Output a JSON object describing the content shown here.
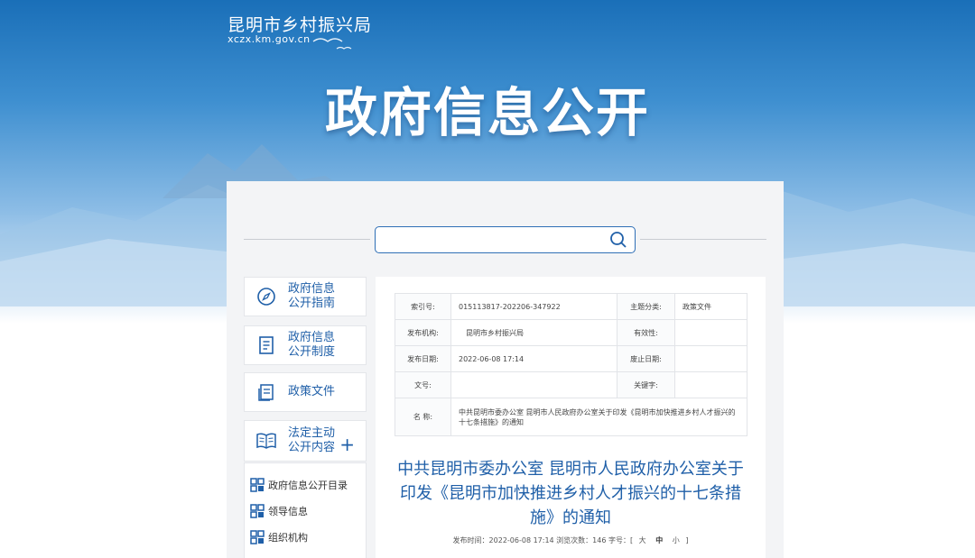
{
  "header": {
    "site_title": "昆明市乡村振兴局",
    "site_url": "xczx.km.gov.cn",
    "hero_title": "政府信息公开"
  },
  "search": {
    "value": "",
    "placeholder": ""
  },
  "sidebar": {
    "items": [
      {
        "label_line1": "政府信息",
        "label_line2": "公开指南",
        "icon": "compass-icon"
      },
      {
        "label_line1": "政府信息",
        "label_line2": "公开制度",
        "icon": "document-list-icon"
      },
      {
        "label": "政策文件",
        "icon": "policy-file-icon"
      },
      {
        "label_line1": "法定主动",
        "label_line2": "公开内容",
        "icon": "open-book-icon",
        "expand": "+"
      }
    ],
    "sub_items": [
      {
        "label": "政府信息公开目录",
        "icon": "grid-icon"
      },
      {
        "label": "领导信息",
        "icon": "grid-icon"
      },
      {
        "label": "组织机构",
        "icon": "grid-icon"
      }
    ]
  },
  "meta_table": {
    "index_label": "索引号:",
    "index_value": "015113817-202206-347922",
    "topic_label": "主题分类:",
    "topic_value": "政策文件",
    "publisher_label": "发布机构:",
    "publisher_value": "昆明市乡村振兴局",
    "validity_label": "有效性:",
    "validity_value": "",
    "pubdate_label": "发布日期:",
    "pubdate_value": "2022-06-08 17:14",
    "expire_label": "废止日期:",
    "expire_value": "",
    "docno_label": "文号:",
    "docno_value": "",
    "keyword_label": "关键字:",
    "keyword_value": "",
    "name_label": "名 称:",
    "name_value": "中共昆明市委办公室 昆明市人民政府办公室关于印发《昆明市加快推进乡村人才振兴的十七条措施》的通知"
  },
  "document": {
    "title_line1": "中共昆明市委办公室 昆明市人民政府办公室关于",
    "title_line2": "印发《昆明市加快推进乡村人才振兴的十七条措",
    "title_line3": "施》的通知",
    "info_prefix": "发布时间：2022-06-08 17:14 浏览次数：146 字号：[",
    "size_large": "大",
    "size_medium": "中",
    "size_small": "小",
    "info_suffix": "]"
  },
  "colors": {
    "brand_blue": "#1f5fa8",
    "border_blue": "#2f6fb6"
  }
}
